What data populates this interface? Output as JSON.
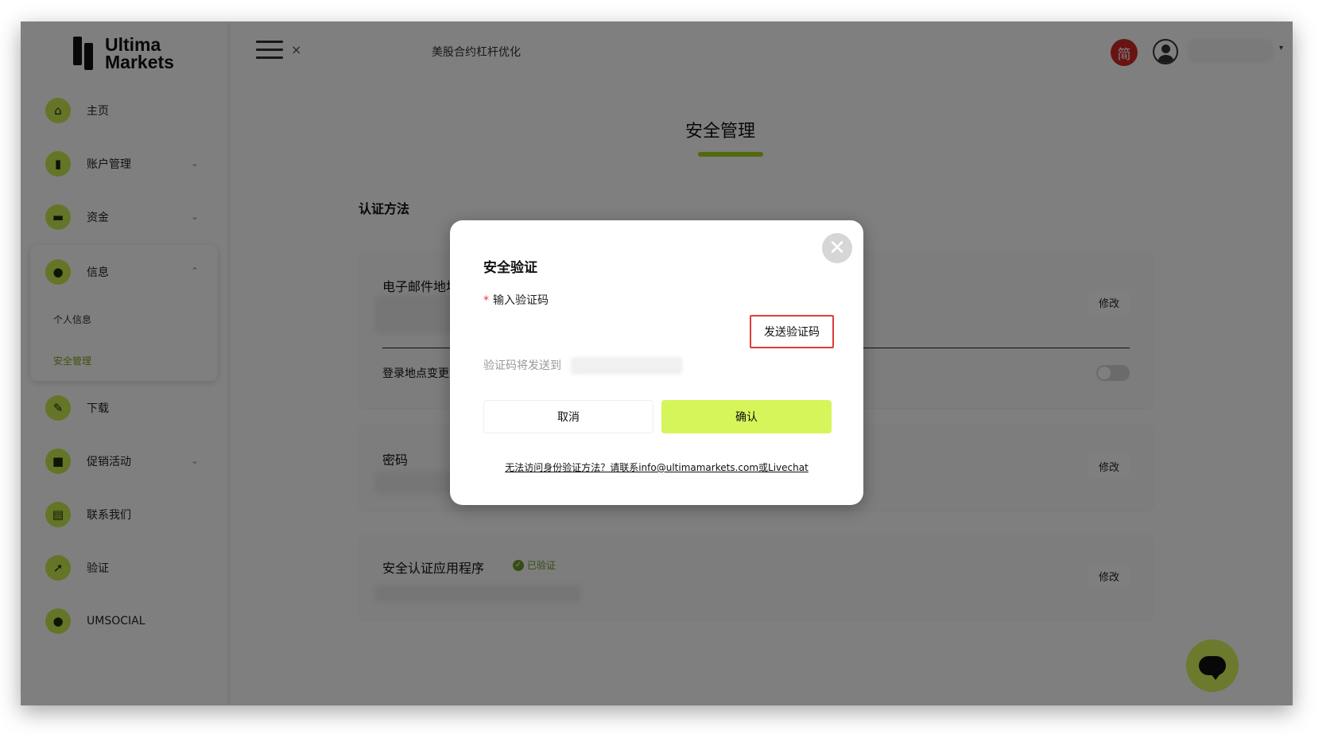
{
  "logo": {
    "line1": "Ultima",
    "line2": "Markets"
  },
  "sidebar": {
    "items": [
      {
        "label": "主页",
        "icon": "home-icon",
        "glyph": "⌂",
        "chevron": ""
      },
      {
        "label": "账户管理",
        "icon": "bar-chart-icon",
        "glyph": "▮",
        "chevron": "⌄"
      },
      {
        "label": "资金",
        "icon": "wallet-icon",
        "glyph": "▬",
        "chevron": "⌄"
      }
    ],
    "group": {
      "label": "信息",
      "icon": "user-icon",
      "glyph": "●",
      "chevron": "⌃",
      "sub_items": [
        {
          "label": "个人信息",
          "active": false
        },
        {
          "label": "安全管理",
          "active": true
        }
      ]
    },
    "items_after": [
      {
        "label": "下载",
        "icon": "wrench-icon",
        "glyph": "✎",
        "chevron": ""
      },
      {
        "label": "促销活动",
        "icon": "gift-icon",
        "glyph": "■",
        "chevron": "⌄"
      },
      {
        "label": "联系我们",
        "icon": "chat-icon",
        "glyph": "▤",
        "chevron": ""
      },
      {
        "label": "验证",
        "icon": "rocket-icon",
        "glyph": "➚",
        "chevron": ""
      },
      {
        "label": "UMSOCIAL",
        "icon": "user-icon",
        "glyph": "●",
        "chevron": ""
      }
    ]
  },
  "topbar": {
    "menu_icon": "hamburger-icon",
    "close_glyph": "×",
    "title": "美股合约杠杆优化",
    "lang_badge": "简",
    "dropdown_glyph": "▾"
  },
  "page": {
    "title": "安全管理",
    "section_title": "认证方法",
    "email_card": {
      "label": "电子邮件地址",
      "edit": "修改",
      "login_change_label": "登录地点变更"
    },
    "password_card": {
      "label": "密码",
      "edit": "修改"
    },
    "auth_app_card": {
      "label": "安全认证应用程序",
      "verified": "已验证",
      "edit": "修改"
    }
  },
  "modal": {
    "title": "安全验证",
    "close_glyph": "✕",
    "field_required_mark": "*",
    "field_label": "输入验证码",
    "input_value": "",
    "send_button": "发送验证码",
    "hint": "验证码将发送到",
    "cancel": "取消",
    "confirm": "确认",
    "help_link": "无法访问身份验证方法？请联系info@ultimamarkets.com或Livechat"
  },
  "colors": {
    "accent": "#c9ea4e",
    "confirm_bg": "#d6f55a",
    "highlight_border": "#e33b3b",
    "lang_badge_bg": "#d02826",
    "verified": "#6b9b2a"
  }
}
